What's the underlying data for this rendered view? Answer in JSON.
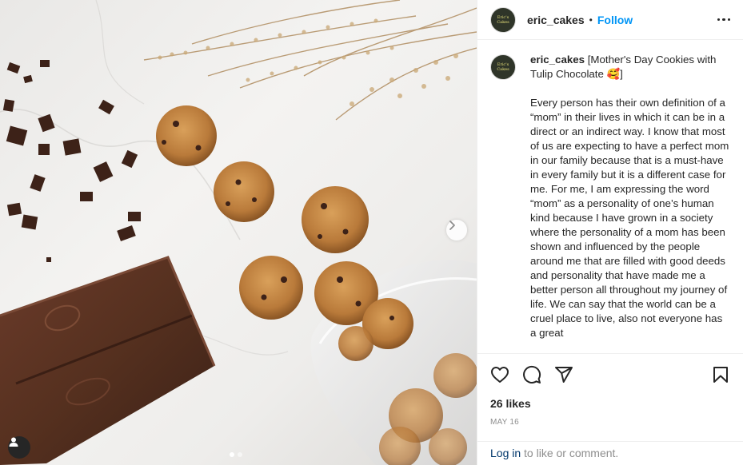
{
  "post": {
    "username": "eric_cakes",
    "separator": "•",
    "follow_label": "Follow",
    "avatar_text_line1": "Eric's",
    "avatar_text_line2": "Cakes",
    "caption_title": "[Mother's Day Cookies with Tulip Chocolate 🥰]",
    "caption_body": "Every person has their own definition of a “mom” in their lives in which it can be in a direct or an indirect way. I know that most of us are expecting to have a perfect mom in our family because that is a must-have in every family but it is a different case for me. For me, I am expressing the word “mom” as a personality of one’s human kind because I have grown in a society where the personality of a mom has been shown and influenced by the people around me that are filled with good deeds and personality that have made me a better person all throughout my journey of life. We can say that the world can be a cruel place to live, also not everyone has a great",
    "likes": "26 likes",
    "date": "MAY 16"
  },
  "login": {
    "link": "Log in",
    "rest": " to like or comment."
  },
  "carousel": {
    "total": 2,
    "active_index": 0
  },
  "icons": {
    "like": "heart-icon",
    "comment": "comment-icon",
    "share": "share-icon",
    "save": "bookmark-icon",
    "next": "chevron-right-icon",
    "tag": "user-tag-icon",
    "more": "more-options-icon"
  },
  "colors": {
    "follow": "#0095f6",
    "link": "#00376b",
    "muted": "#8e8e8e",
    "text": "#262626"
  }
}
